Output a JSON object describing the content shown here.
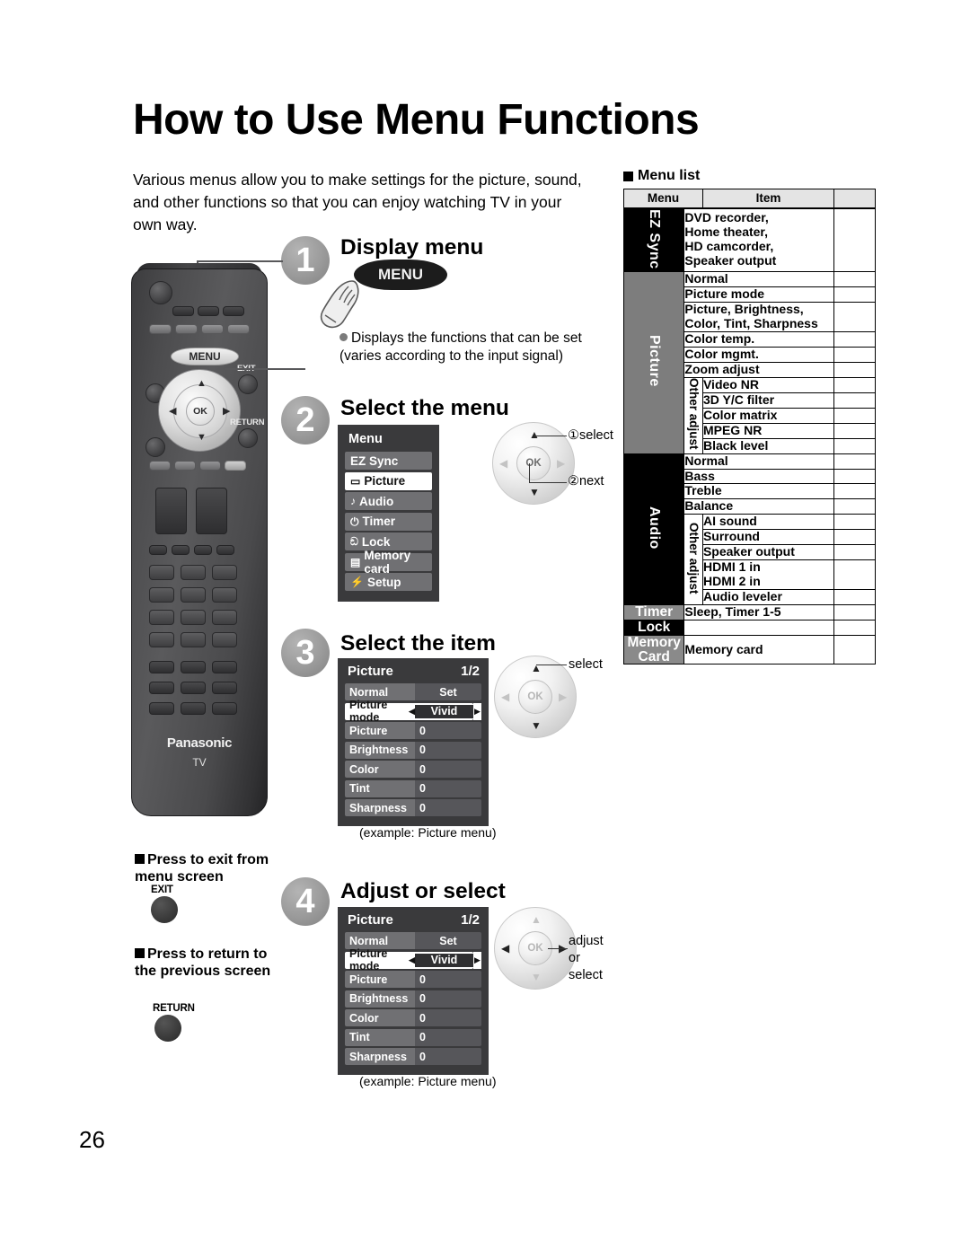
{
  "page": {
    "title": "How to Use Menu Functions",
    "intro": "Various menus allow you to make settings for the picture, sound, and other functions so that you can enjoy watching TV in your own way.",
    "page_number": "26"
  },
  "menu_list": {
    "heading": "Menu list",
    "columns": [
      "Menu",
      "Item"
    ],
    "groups": [
      {
        "category": "EZ Sync",
        "category_color": "#000000",
        "rows": [
          {
            "item": "DVD recorder,\nHome theater,\nHD camcorder,\nSpeaker output"
          }
        ]
      },
      {
        "category": "Picture",
        "category_color": "#7d7d7d",
        "rows": [
          {
            "item": "Normal"
          },
          {
            "item": "Picture mode"
          },
          {
            "item": "Picture, Brightness,\nColor, Tint, Sharpness"
          },
          {
            "item": "Color temp."
          },
          {
            "item": "Color mgmt."
          },
          {
            "item": "Zoom adjust"
          }
        ],
        "sub": {
          "label": "Other adjust",
          "rows": [
            {
              "item": "Video NR"
            },
            {
              "item": "3D Y/C filter"
            },
            {
              "item": "Color matrix"
            },
            {
              "item": "MPEG NR"
            },
            {
              "item": "Black level"
            }
          ]
        }
      },
      {
        "category": "Audio",
        "category_color": "#000000",
        "rows": [
          {
            "item": "Normal"
          },
          {
            "item": "Bass"
          },
          {
            "item": "Treble"
          },
          {
            "item": "Balance"
          }
        ],
        "sub": {
          "label": "Other adjust",
          "rows": [
            {
              "item": "AI sound"
            },
            {
              "item": "Surround"
            },
            {
              "item": "Speaker output"
            },
            {
              "item": "HDMI 1 in\nHDMI 2 in"
            },
            {
              "item": "Audio leveler"
            }
          ]
        }
      },
      {
        "category": "Timer",
        "category_color": "#8a8a8a",
        "rows": [
          {
            "item": "Sleep, Timer 1-5"
          }
        ]
      },
      {
        "category": "Lock",
        "category_color": "#000000",
        "rows": [
          {
            "item": ""
          }
        ]
      },
      {
        "category": "Memory\nCard",
        "category_color": "#8a8a8a",
        "rows": [
          {
            "item": "Memory card"
          }
        ]
      }
    ]
  },
  "steps": [
    {
      "number": "1",
      "title": "Display menu",
      "button_label": "MENU",
      "note": "Displays the functions that can be set (varies according to the input signal)"
    },
    {
      "number": "2",
      "title": "Select the menu",
      "callout_select": "①select",
      "callout_next": "②next"
    },
    {
      "number": "3",
      "title": "Select the item",
      "callout_select": "select",
      "caption": "(example:  Picture menu)"
    },
    {
      "number": "4",
      "title": "Adjust or select",
      "callout_adjust": "adjust\nor\nselect",
      "caption": "(example:  Picture menu)"
    }
  ],
  "osd_menu": {
    "title": "Menu",
    "items": [
      {
        "icon": "",
        "label": "EZ Sync",
        "selected": false
      },
      {
        "icon": "▭",
        "label": "Picture",
        "selected": true
      },
      {
        "icon": "♪",
        "label": "Audio",
        "selected": false
      },
      {
        "icon": "⏻",
        "label": "Timer",
        "selected": false
      },
      {
        "icon": "ඞ",
        "label": "Lock",
        "selected": false
      },
      {
        "icon": "▤",
        "label": "Memory card",
        "selected": false
      },
      {
        "icon": "⚡",
        "label": "Setup",
        "selected": false
      }
    ]
  },
  "osd_picture": {
    "title": "Picture",
    "page": "1/2",
    "rows": [
      {
        "label": "Normal",
        "value": "Set",
        "selected": false,
        "center": true
      },
      {
        "label": "Picture mode",
        "value": "Vivid",
        "selected": true,
        "center": true
      },
      {
        "label": "Picture",
        "value": "0",
        "selected": false,
        "center": false
      },
      {
        "label": "Brightness",
        "value": "0",
        "selected": false,
        "center": false
      },
      {
        "label": "Color",
        "value": "0",
        "selected": false,
        "center": false
      },
      {
        "label": "Tint",
        "value": "0",
        "selected": false,
        "center": false
      },
      {
        "label": "Sharpness",
        "value": "0",
        "selected": false,
        "center": false
      }
    ]
  },
  "press_notes": [
    {
      "text": "Press to exit from menu screen",
      "button": "EXIT"
    },
    {
      "text": "Press to return to the previous screen",
      "button": "RETURN"
    }
  ],
  "remote": {
    "menu_key": "MENU",
    "ok_key": "OK",
    "exit_key": "EXIT",
    "return_key": "RETURN",
    "brand": "Panasonic",
    "model_label": "TV"
  },
  "colors": {
    "osd_background": "#3a3a3c",
    "osd_row": "#707073",
    "osd_selected": "#ffffff",
    "step_circle": "#9a9a9a",
    "table_header": "#e4e4e4"
  }
}
